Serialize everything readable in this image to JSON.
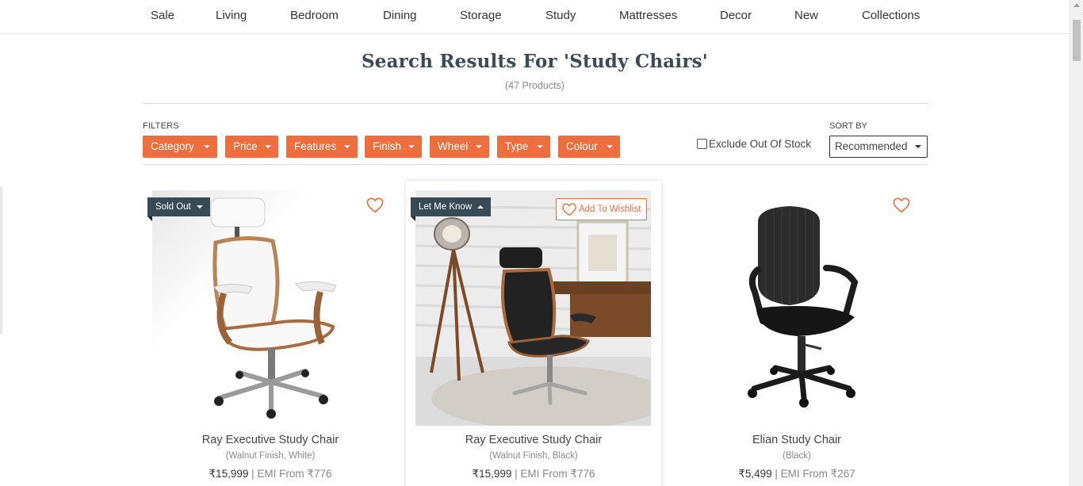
{
  "nav": {
    "items": [
      "Sale",
      "Living",
      "Bedroom",
      "Dining",
      "Storage",
      "Study",
      "Mattresses",
      "Decor",
      "New",
      "Collections"
    ]
  },
  "search": {
    "title": "Search Results For 'Study Chairs'",
    "count": "(47 Products)"
  },
  "filters": {
    "label": "FILTERS",
    "buttons": [
      "Category",
      "Price",
      "Features",
      "Finish",
      "Wheel",
      "Type",
      "Colour"
    ],
    "exclude_label": "Exclude Out Of Stock",
    "exclude_checked": false
  },
  "sort": {
    "label": "SORT BY",
    "value": "Recommended"
  },
  "products": [
    {
      "name": "Ray Executive Study Chair",
      "variant": "(Walnut Finish, White)",
      "price": "₹15,999",
      "emi": "| EMI From ₹776",
      "badge": "Sold Out"
    },
    {
      "name": "Ray Executive Study Chair",
      "variant": "(Walnut Finish, Black)",
      "price": "₹15,999",
      "emi": "| EMI From ₹776",
      "badge": "Let Me Know",
      "wishlist_label": "Add To Wishlist"
    },
    {
      "name": "Elian Study Chair",
      "variant": "(Black)",
      "price": "₹5,499",
      "emi": "| EMI From ₹267"
    }
  ],
  "colors": {
    "accent": "#ef6e3e",
    "badge": "#384a56",
    "title": "#3b4a55"
  }
}
